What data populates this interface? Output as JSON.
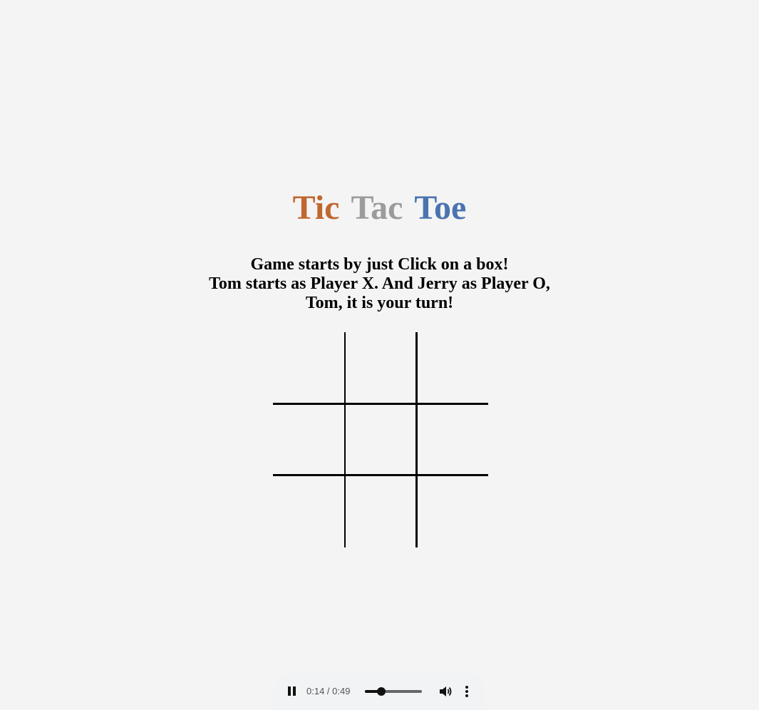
{
  "title": {
    "words": [
      "Tic",
      "Tac",
      "Toe"
    ],
    "colors": [
      "#c0672f",
      "#9b9b9b",
      "#4a73b0"
    ]
  },
  "messages": [
    "Game starts by just Click on a box!",
    "Tom starts as Player X. And Jerry as Player O,",
    "Tom, it is your turn!"
  ],
  "board": {
    "cells": [
      "",
      "",
      "",
      "",
      "",
      "",
      "",
      "",
      ""
    ]
  },
  "audio_player": {
    "current_time": "0:14",
    "duration": "0:49",
    "time_display": "0:14 / 0:49",
    "progress_fraction": 0.286,
    "play_state_icon": "pause-icon",
    "volume_icon": "volume-icon",
    "menu_icon": "more-vert-icon"
  }
}
